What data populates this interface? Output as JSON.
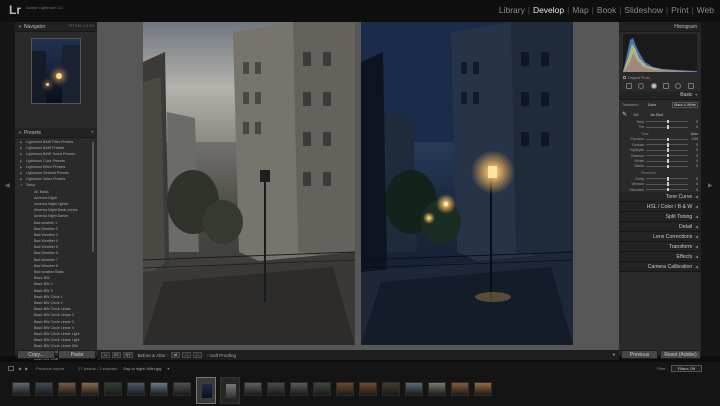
{
  "app": {
    "logo": "Lr",
    "name": "Adobe Lightroom CC"
  },
  "modules": [
    {
      "label": "Library",
      "active": false
    },
    {
      "label": "Develop",
      "active": true
    },
    {
      "label": "Map",
      "active": false
    },
    {
      "label": "Book",
      "active": false
    },
    {
      "label": "Slideshow",
      "active": false
    },
    {
      "label": "Print",
      "active": false
    },
    {
      "label": "Web",
      "active": false
    }
  ],
  "navigator": {
    "title": "Navigator",
    "zoom_options": "FIT  FILL  1:1  3:1"
  },
  "presets": {
    "title": "Presets",
    "folders": [
      "Lightroom B&W Filter Presets",
      "Lightroom B&W Presets",
      "Lightroom B&W Toned Presets",
      "Lightroom Color Presets",
      "Lightroom Effect Presets",
      "Lightroom General Presets",
      "Lightroom Video Presets"
    ],
    "open_folder": "Setup",
    "items": [
      "AK Basic",
      "America Night",
      "America Night Lighter",
      "America Night Basic circles",
      "America Night Darker",
      "Bad weather 1",
      "Bad Weather 2",
      "Bad Weather 3",
      "Bad Weather 4",
      "Bad Weather 5",
      "Bad Weather 6",
      "Bad Weather 7",
      "Bad Weather 8",
      "Bad weather Basic",
      "Basic BW",
      "Basic BW 2",
      "Basic BW 3",
      "Basic BW Circle 1",
      "Basic BW Circle 2",
      "Basic BW Circle Linear",
      "Basic BW Circle Linear 2",
      "Basic BW Circle Linear 3",
      "Basic BW Circle Linear 4",
      "Basic BW Circle Linear Light",
      "Basic BW Circle Linear Light",
      "Basic BW Circle Linear Wid",
      "Basic BW Circle Linear Wid",
      "Basic BW Dear"
    ]
  },
  "left_buttons": {
    "copy": "Copy...",
    "paste": "Paste"
  },
  "toolbar": {
    "mode_label": "Before & After :",
    "soft_proofing": "Soft Proofing"
  },
  "right": {
    "histogram_title": "Histogram",
    "original_photo": "Original Photo",
    "basic_title": "Basic",
    "treatment_label": "Treatment :",
    "treatment_color": "Color",
    "treatment_bw": "Black & White",
    "wb_label": "WB :",
    "wb_value": "As Shot",
    "tone_label": "Tone",
    "tone_auto": "Auto",
    "presence_label": "Presence",
    "sliders_wb": [
      {
        "label": "Temp",
        "value": "0",
        "pos": 0.5
      },
      {
        "label": "Tint",
        "value": "0",
        "pos": 0.5
      }
    ],
    "sliders_tone": [
      {
        "label": "Exposure",
        "value": "0.00",
        "pos": 0.5
      },
      {
        "label": "Contrast",
        "value": "0",
        "pos": 0.5
      },
      {
        "label": "Highlights",
        "value": "0",
        "pos": 0.5
      },
      {
        "label": "Shadows",
        "value": "0",
        "pos": 0.5
      },
      {
        "label": "Whites",
        "value": "0",
        "pos": 0.5
      },
      {
        "label": "Blacks",
        "value": "0",
        "pos": 0.5
      }
    ],
    "sliders_presence": [
      {
        "label": "Clarity",
        "value": "0",
        "pos": 0.5
      },
      {
        "label": "Vibrance",
        "value": "0",
        "pos": 0.5
      },
      {
        "label": "Saturation",
        "value": "0",
        "pos": 0.5
      }
    ],
    "sections": [
      "Tone Curve",
      "HSL / Color / B & W",
      "Split Toning",
      "Detail",
      "Lens Corrections",
      "Transform",
      "Effects",
      "Camera Calibration"
    ],
    "previous": "Previous",
    "reset": "Reset (Adobe)"
  },
  "filmstrip": {
    "source": "Previous Import",
    "count": "27 photos / 1 selected",
    "path": "Day to night: After.jpg",
    "filter_label": "Filter :",
    "filter_value": "Filters Off"
  }
}
